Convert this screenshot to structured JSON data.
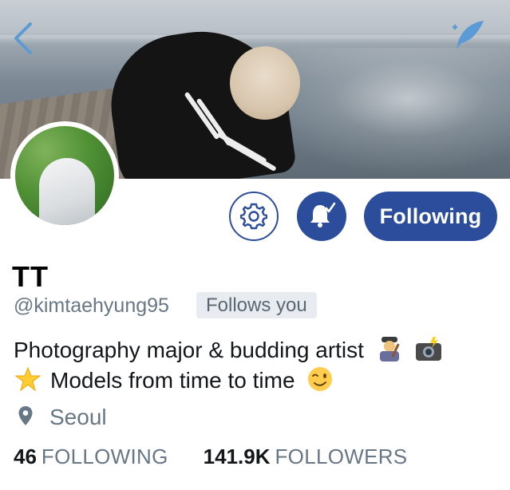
{
  "profile": {
    "display_name": "TT",
    "handle": "@kimtaehyung95",
    "follows_you_badge": "Follows you",
    "bio_line1": "Photography major & budding artist",
    "bio_line2": "Models from time to time",
    "location": "Seoul"
  },
  "actions": {
    "following_label": "Following",
    "settings_icon": "gear-icon",
    "notify_icon": "bell-check-icon"
  },
  "stats": {
    "following_count": "46",
    "following_label": "FOLLOWING",
    "followers_count": "141.9K",
    "followers_label": "FOLLOWERS"
  },
  "colors": {
    "accent": "#2b4d9c",
    "muted_text": "#687785",
    "badge_bg": "#e8ebef"
  },
  "icons": {
    "back": "chevron-left-icon",
    "compose": "feather-compose-icon",
    "location": "map-pin-icon",
    "bio_emoji_1": "artist-emoji-icon",
    "bio_emoji_2": "camera-flash-emoji-icon",
    "bio_emoji_3": "glowing-star-emoji-icon",
    "bio_emoji_4": "winking-face-emoji-icon"
  }
}
